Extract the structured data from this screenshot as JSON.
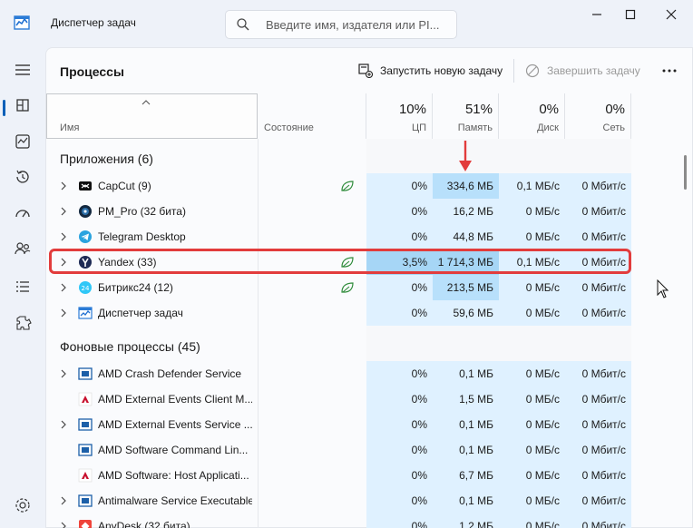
{
  "window": {
    "title": "Диспетчер задач",
    "search_placeholder": "Введите имя, издателя или PI..."
  },
  "toolbar": {
    "page_title": "Процессы",
    "run_task": "Запустить новую задачу",
    "end_task": "Завершить задачу"
  },
  "columns": {
    "name": "Имя",
    "status": "Состояние",
    "cpu_pct": "10%",
    "cpu": "ЦП",
    "mem_pct": "51%",
    "mem": "Память",
    "disk_pct": "0%",
    "disk": "Диск",
    "net_pct": "0%",
    "net": "Сеть"
  },
  "groups": {
    "apps": "Приложения (6)",
    "background": "Фоновые процессы (45)"
  },
  "apps": [
    {
      "name": "CapCut (9)",
      "cpu": "0%",
      "mem": "334,6 МБ",
      "disk": "0,1 МБ/с",
      "net": "0 Мбит/с",
      "icon": "capcut-icon",
      "leaf": true
    },
    {
      "name": "PM_Pro (32 бита)",
      "cpu": "0%",
      "mem": "16,2 МБ",
      "disk": "0 МБ/с",
      "net": "0 Мбит/с",
      "icon": "pmpro-icon",
      "leaf": false
    },
    {
      "name": "Telegram Desktop",
      "cpu": "0%",
      "mem": "44,8 МБ",
      "disk": "0 МБ/с",
      "net": "0 Мбит/с",
      "icon": "telegram-icon",
      "leaf": false
    },
    {
      "name": "Yandex (33)",
      "cpu": "3,5%",
      "mem": "1 714,3 МБ",
      "disk": "0,1 МБ/с",
      "net": "0 Мбит/с",
      "icon": "yandex-icon",
      "leaf": true
    },
    {
      "name": "Битрикс24 (12)",
      "cpu": "0%",
      "mem": "213,5 МБ",
      "disk": "0 МБ/с",
      "net": "0 Мбит/с",
      "icon": "bitrix-icon",
      "leaf": true
    },
    {
      "name": "Диспетчер задач",
      "cpu": "0%",
      "mem": "59,6 МБ",
      "disk": "0 МБ/с",
      "net": "0 Мбит/с",
      "icon": "taskmgr-icon",
      "leaf": false
    }
  ],
  "background": [
    {
      "name": "AMD Crash Defender Service",
      "cpu": "0%",
      "mem": "0,1 МБ",
      "disk": "0 МБ/с",
      "net": "0 Мбит/с",
      "chevron": true,
      "icon": "service-icon"
    },
    {
      "name": "AMD External Events Client M...",
      "cpu": "0%",
      "mem": "1,5 МБ",
      "disk": "0 МБ/с",
      "net": "0 Мбит/с",
      "chevron": false,
      "icon": "amd-icon"
    },
    {
      "name": "AMD External Events Service ...",
      "cpu": "0%",
      "mem": "0,1 МБ",
      "disk": "0 МБ/с",
      "net": "0 Мбит/с",
      "chevron": true,
      "icon": "service-icon"
    },
    {
      "name": "AMD Software Command Lin...",
      "cpu": "0%",
      "mem": "0,1 МБ",
      "disk": "0 МБ/с",
      "net": "0 Мбит/с",
      "chevron": false,
      "icon": "service-icon"
    },
    {
      "name": "AMD Software: Host Applicati...",
      "cpu": "0%",
      "mem": "6,7 МБ",
      "disk": "0 МБ/с",
      "net": "0 Мбит/с",
      "chevron": false,
      "icon": "amd-icon"
    },
    {
      "name": "Antimalware Service Executable",
      "cpu": "0%",
      "mem": "0,1 МБ",
      "disk": "0 МБ/с",
      "net": "0 Мбит/с",
      "chevron": true,
      "icon": "service-icon"
    },
    {
      "name": "AnyDesk (32 бита)",
      "cpu": "0%",
      "mem": "1,2 МБ",
      "disk": "0 МБ/с",
      "net": "0 Мбит/с",
      "chevron": true,
      "icon": "anydesk-icon"
    }
  ],
  "colors": {
    "heat_light": "#dff1ff",
    "heat_mid": "#b8e0fb",
    "heat_strong": "#a6d6f6",
    "highlight": "#e23c3c",
    "accent": "#005fb8"
  }
}
